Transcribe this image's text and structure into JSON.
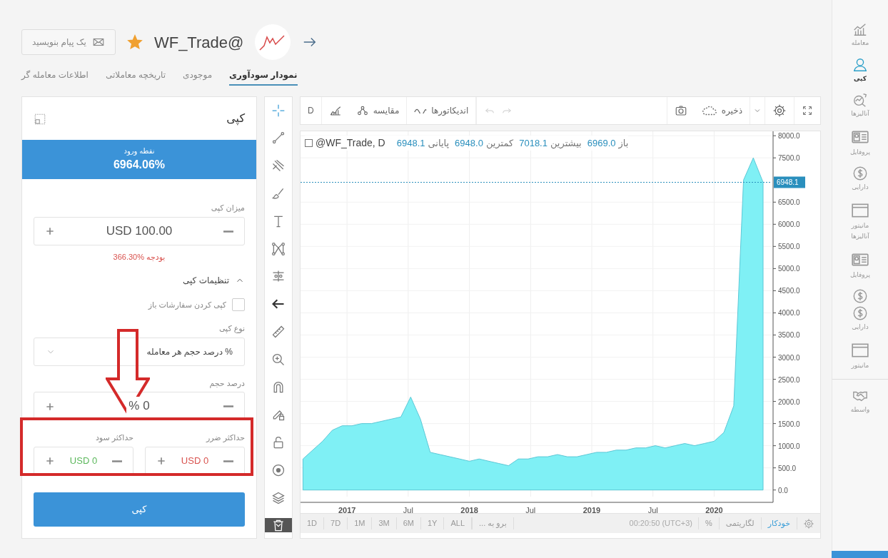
{
  "header": {
    "username": "WF_Trade@",
    "favorite": true,
    "message_button": "یک پیام بنویسید"
  },
  "tabs": [
    {
      "label": "نمودار سودآوری",
      "selected": true
    },
    {
      "label": "موجودی",
      "selected": false
    },
    {
      "label": "تاریخچه معاملاتی",
      "selected": false
    },
    {
      "label": "اطلاعات معامله گر",
      "selected": false
    }
  ],
  "copy_panel": {
    "title": "کپی",
    "entry": {
      "label": "نقطه ورود",
      "value": "6964.06%"
    },
    "amount": {
      "label": "میزان کپی",
      "value": "USD 100.00"
    },
    "budget": "366.30% بودجه",
    "settings": {
      "label": "تنظیمات کپی",
      "expanded": true
    },
    "copy_open_orders": {
      "label": "کپی کردن سفارشات باز",
      "checked": false
    },
    "copy_type": {
      "label": "نوع کپی",
      "value": "% درصد حجم هر معامله"
    },
    "volume_percent": {
      "label": "درصد حجم",
      "value": "% 0"
    },
    "limits": [
      {
        "label": "حداکثر ضرر",
        "value": "USD 0",
        "color": "#d9534f"
      },
      {
        "label": "حداکثر سود",
        "value": "USD 0",
        "color": "#5cb85c"
      }
    ],
    "submit": "کپی"
  },
  "chart_toolbar": {
    "interval": "D",
    "compare": "مقایسه",
    "indicators": "اندیکاتورها",
    "undo_disabled": true,
    "redo_disabled": true,
    "save": "ذخیره"
  },
  "chart": {
    "ohlc": [
      {
        "label": "باز",
        "value": "6969.0"
      },
      {
        "label": "بیشترین",
        "value": "7018.1"
      },
      {
        "label": "کمترین",
        "value": "6948.0"
      },
      {
        "label": "پایانی",
        "value": "6948.1"
      }
    ],
    "chart_data": {
      "type": "area",
      "x": [
        2016.64,
        2016.72,
        2016.8,
        2016.88,
        2016.96,
        2017.04,
        2017.12,
        2017.2,
        2017.28,
        2017.36,
        2017.44,
        2017.52,
        2017.6,
        2017.68,
        2017.76,
        2017.84,
        2017.92,
        2018.0,
        2018.08,
        2018.16,
        2018.24,
        2018.32,
        2018.4,
        2018.48,
        2018.56,
        2018.64,
        2018.72,
        2018.8,
        2018.88,
        2018.96,
        2019.04,
        2019.12,
        2019.2,
        2019.28,
        2019.36,
        2019.44,
        2019.52,
        2019.6,
        2019.68,
        2019.76,
        2019.84,
        2019.92,
        2020.0,
        2020.08,
        2020.16,
        2020.24,
        2020.32,
        2020.4
      ],
      "series": [
        {
          "name": "@WF_Trade, D",
          "color": "#5bc8d6",
          "values": [
            700,
            900,
            1100,
            1350,
            1450,
            1450,
            1500,
            1500,
            1550,
            1600,
            1650,
            2100,
            1600,
            850,
            800,
            750,
            700,
            650,
            700,
            650,
            600,
            550,
            700,
            700,
            750,
            750,
            800,
            750,
            750,
            800,
            850,
            850,
            900,
            900,
            950,
            950,
            1000,
            950,
            1000,
            1050,
            1000,
            1050,
            1100,
            1300,
            1900,
            7000,
            7500,
            6950
          ]
        }
      ],
      "xlim": [
        2016.62,
        2020.47
      ],
      "ylim": [
        -150,
        8100
      ],
      "grid": true,
      "xticks": [
        {
          "value": 2017,
          "label": "2017"
        },
        {
          "value": 2017.5,
          "label": "Jul"
        },
        {
          "value": 2018,
          "label": "2018"
        },
        {
          "value": 2018.5,
          "label": "Jul"
        },
        {
          "value": 2019,
          "label": "2019"
        },
        {
          "value": 2019.5,
          "label": "Jul"
        },
        {
          "value": 2020,
          "label": "2020"
        }
      ],
      "yticks": [
        {
          "value": 0,
          "label": "0.0"
        },
        {
          "value": 500,
          "label": "500.0"
        },
        {
          "value": 1000,
          "label": "1000.0"
        },
        {
          "value": 1500,
          "label": "1500.0"
        },
        {
          "value": 2000,
          "label": "2000.0"
        },
        {
          "value": 2500,
          "label": "2500.0"
        },
        {
          "value": 3000,
          "label": "3000.0"
        },
        {
          "value": 3500,
          "label": "3500.0"
        },
        {
          "value": 4000,
          "label": "4000.0"
        },
        {
          "value": 4500,
          "label": "4500.0"
        },
        {
          "value": 5000,
          "label": "5000.0"
        },
        {
          "value": 5500,
          "label": "5500.0"
        },
        {
          "value": 6000,
          "label": "6000.0"
        },
        {
          "value": 6500,
          "label": "6500.0"
        },
        {
          "value": 7500,
          "label": "7500.0"
        },
        {
          "value": 8000,
          "label": "8000.0"
        }
      ],
      "ref_lines": [
        {
          "axis": "y",
          "value": 6948.1,
          "label": "6948.1"
        }
      ]
    }
  },
  "bottom_bar": {
    "modes": [
      {
        "label": "خودکار",
        "selected": true
      },
      {
        "label": "لگاریتمی",
        "selected": false
      },
      {
        "label": "%",
        "selected": false
      }
    ],
    "time": "00:20:50 (UTC+3)",
    "goto": "برو به ...",
    "ranges": [
      "ALL",
      "1Y",
      "6M",
      "3M",
      "1M",
      "7D",
      "1D"
    ]
  },
  "sidebar": {
    "items": [
      {
        "kind": "trade",
        "label": "معامله",
        "selected": false
      },
      {
        "kind": "user",
        "label": "کپی",
        "selected": true
      },
      {
        "kind": "analysis",
        "label": "آنالیزها",
        "selected": false
      },
      {
        "kind": "profile",
        "label": "پروفایل",
        "selected": false
      },
      {
        "kind": "dollar",
        "label": "دارایی",
        "selected": false
      },
      {
        "kind": "monitor",
        "label": "مانیتور",
        "sublabel": "آنالیزها",
        "selected": false
      },
      {
        "kind": "profile",
        "label": "پروفایل",
        "selected": false
      },
      {
        "kind": "dollar-double",
        "label": "دارایی",
        "selected": false
      },
      {
        "kind": "monitor",
        "label": "مانیتور",
        "selected": false
      },
      {
        "kind": "handshake",
        "label": "واسطه",
        "selected": false
      }
    ]
  }
}
